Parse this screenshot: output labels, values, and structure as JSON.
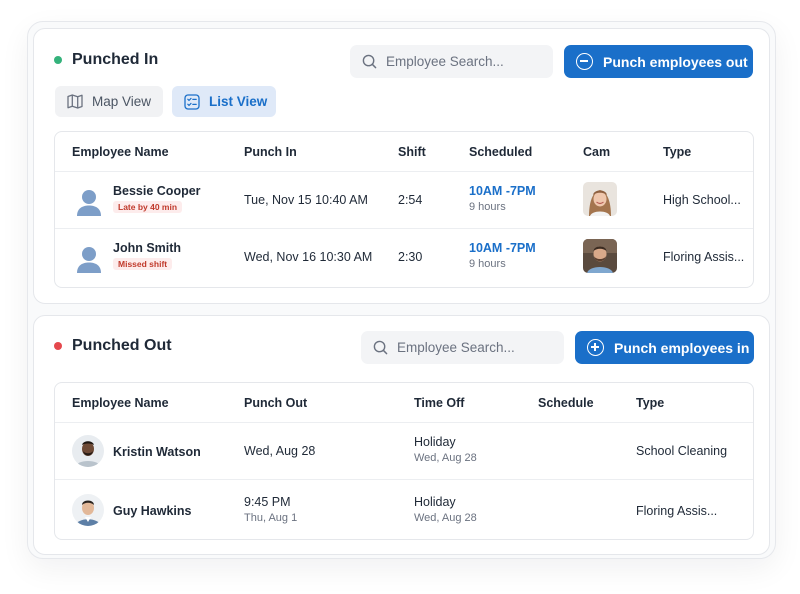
{
  "punched_in": {
    "title": "Punched In",
    "status_color": "#34b27b",
    "search_placeholder": "Employee Search...",
    "action_label": "Punch employees out",
    "view_toggle": {
      "map_label": "Map View",
      "list_label": "List View",
      "selected": "List View"
    },
    "columns": [
      "Employee Name",
      "Punch In",
      "Shift",
      "Scheduled",
      "Cam",
      "Type"
    ],
    "rows": [
      {
        "name": "Bessie Cooper",
        "badge": "Late by 40 min",
        "punch_in": "Tue, Nov 15 10:40 AM",
        "shift": "2:54",
        "scheduled": "10AM -7PM",
        "scheduled_sub": "9 hours",
        "type": "High School..."
      },
      {
        "name": "John Smith",
        "badge": "Missed shift",
        "punch_in": "Wed, Nov 16 10:30 AM",
        "shift": "2:30",
        "scheduled": "10AM -7PM",
        "scheduled_sub": "9 hours",
        "type": "Floring Assis..."
      }
    ]
  },
  "punched_out": {
    "title": "Punched Out",
    "status_color": "#e5484d",
    "search_placeholder": "Employee Search...",
    "action_label": "Punch employees in",
    "columns": [
      "Employee Name",
      "Punch Out",
      "Time Off",
      "Schedule",
      "Type"
    ],
    "rows": [
      {
        "name": "Kristin Watson",
        "punch_out": "Wed, Aug 28",
        "punch_out_sub": "",
        "time_off": "Holiday",
        "time_off_sub": "Wed, Aug 28",
        "schedule": "",
        "type": "School Cleaning"
      },
      {
        "name": "Guy Hawkins",
        "punch_out": "9:45 PM",
        "punch_out_sub": "Thu, Aug 1",
        "time_off": "Holiday",
        "time_off_sub": "Wed, Aug 28",
        "schedule": "",
        "type": "Floring Assis..."
      }
    ]
  },
  "icons": {
    "search": "search-icon",
    "minus_circle": "minus-circle-icon",
    "plus_circle": "plus-circle-icon",
    "map": "map-icon",
    "list": "checklist-icon",
    "avatar": "person-icon"
  },
  "colors": {
    "primary": "#1a6fc9",
    "badge_text": "#c0392b",
    "badge_bg": "#fdecec"
  }
}
